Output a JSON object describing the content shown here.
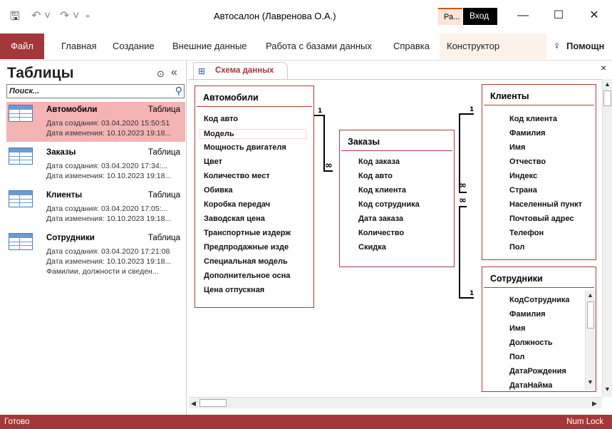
{
  "titlebar": {
    "title": "Автосалон (Лавренова О.А.)",
    "context_tab": "Ра...",
    "signin": "Вход",
    "minimize": "—",
    "maximize": "☐",
    "close": "✕"
  },
  "ribbon": {
    "tabs": [
      "Файл",
      "Главная",
      "Создание",
      "Внешние данные",
      "Работа с базами данных",
      "Справка",
      "Конструктор"
    ],
    "help": "Помощн"
  },
  "nav": {
    "title": "Таблицы",
    "search_placeholder": "Поиск...",
    "items": [
      {
        "name": "Автомобили",
        "kind": "Таблица",
        "created": "Дата создания: 03.04.2020 15:50:51",
        "modified": "Дата изменения: 10.10.2023 19:18..."
      },
      {
        "name": "Заказы",
        "kind": "Таблица",
        "created": "Дата создания: 03.04.2020 17:34:...",
        "modified": "Дата изменения: 10.10.2023 19:18..."
      },
      {
        "name": "Клиенты",
        "kind": "Таблица",
        "created": "Дата создания: 03.04.2020 17:05:...",
        "modified": "Дата изменения: 10.10.2023 19:18..."
      },
      {
        "name": "Сотрудники",
        "kind": "Таблица",
        "created": "Дата создания: 03.04.2020 17:21:08",
        "modified": "Дата изменения: 10.10.2023 19:18...",
        "description": "Фамилии, должности и сведен..."
      }
    ]
  },
  "document": {
    "tab_label": "Схема данных",
    "tables": {
      "cars": {
        "name": "Автомобили",
        "fields": [
          "Код авто",
          "Модель",
          "Мощность двигателя",
          "Цвет",
          "Количество мест",
          "Обивка",
          "Коробка передач",
          "Заводская цена",
          "Транспортные издерж",
          "Предпродажные изде",
          "Специальная модель",
          "Дополнительное осна",
          "Цена отпускная"
        ]
      },
      "orders": {
        "name": "Заказы",
        "fields": [
          "Код заказа",
          "Код авто",
          "Код клиента",
          "Код сотрудника",
          "Дата заказа",
          "Количество",
          "Скидка"
        ]
      },
      "clients": {
        "name": "Клиенты",
        "fields": [
          "Код клиента",
          "Фамилия",
          "Имя",
          "Отчество",
          "Индекс",
          "Страна",
          "Населенный пункт",
          "Почтовый адрес",
          "Телефон",
          "Пол"
        ]
      },
      "employees": {
        "name": "Сотрудники",
        "fields": [
          "КодСотрудника",
          "Фамилия",
          "Имя",
          "Должность",
          "Пол",
          "ДатаРождения",
          "ДатаНайма"
        ]
      }
    },
    "relations": {
      "one": "1",
      "many": "∞"
    }
  },
  "status": {
    "left": "Готово",
    "right": "Num Lock"
  },
  "colors": {
    "accent": "#a4373a",
    "table_border": "#b03a3a",
    "selected": "#f4b4b4"
  }
}
